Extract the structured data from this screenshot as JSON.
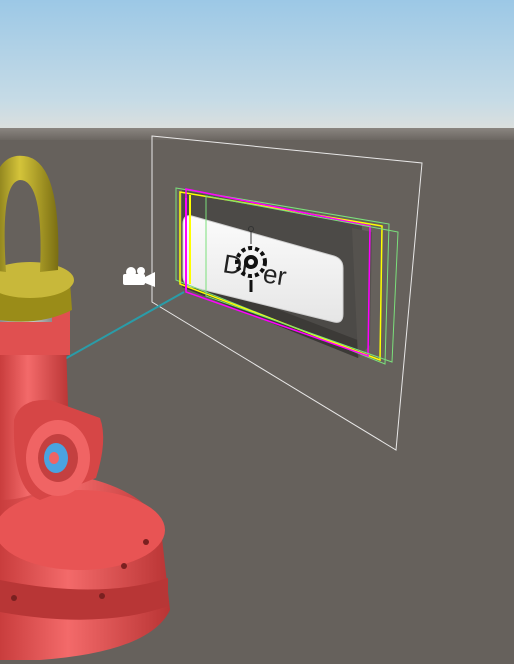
{
  "viewport": {
    "kind": "scene-view",
    "sky_top_color": "#9cc8e6",
    "horizon_color": "#d8dcdc",
    "ground_color": "#66615c"
  },
  "ui_button": {
    "label": "Dr",
    "label_tail": "er",
    "face_color": "#f4f4f4",
    "outline_colors": [
      "#ffff00",
      "#ff00ff",
      "#7be07b"
    ]
  },
  "gizmos": {
    "camera_icon": "camera-icon",
    "transform_gizmo_icon": "pivot-gizmo-icon",
    "canvas_frame_color": "#ffffff",
    "camera_ray_color": "#2a9ca8"
  },
  "model": {
    "name": "lifting-eye-bolt-fitting",
    "body_color": "#ef5b5b",
    "ring_color": "#b8a82a",
    "port_color": "#4aa3e0"
  }
}
